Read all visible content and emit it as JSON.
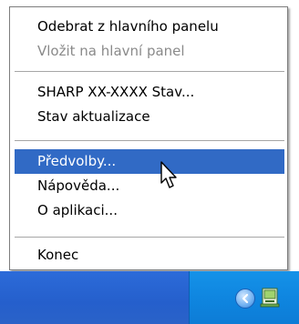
{
  "menu": {
    "items": [
      {
        "label": "Odebrat z hlavního panelu",
        "disabled": false,
        "selected": false
      },
      {
        "label": "Vložit na hlavní panel",
        "disabled": true,
        "selected": false
      },
      {
        "label": "SHARP XX-XXXX Stav...",
        "disabled": false,
        "selected": false
      },
      {
        "label": "Stav aktualizace",
        "disabled": false,
        "selected": false
      },
      {
        "label": "Předvolby...",
        "disabled": false,
        "selected": true
      },
      {
        "label": "Nápověda...",
        "disabled": false,
        "selected": false
      },
      {
        "label": "O aplikaci...",
        "disabled": false,
        "selected": false
      },
      {
        "label": "Konec",
        "disabled": false,
        "selected": false
      }
    ]
  },
  "colors": {
    "selection": "#316ac5",
    "taskbar": "#255fcc",
    "tray": "#0f86e0",
    "disabled_text": "#8a8a8a"
  },
  "icons": {
    "tray_chevron": "chevron-left-icon",
    "tray_app": "printer-status-icon",
    "cursor": "mouse-pointer-icon"
  }
}
